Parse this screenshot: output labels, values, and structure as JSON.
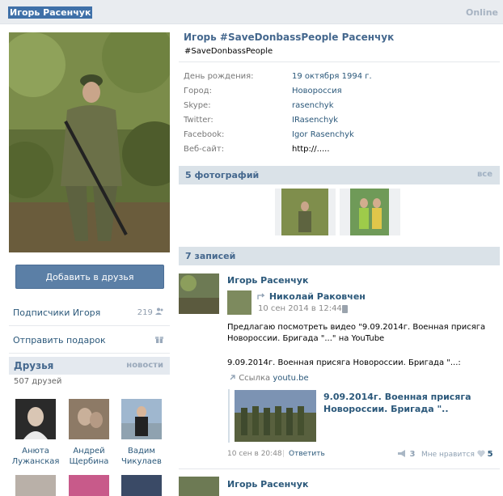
{
  "header": {
    "name": "Игорь Расенчук",
    "status": "Online"
  },
  "profile": {
    "full_name": "Игорь #SaveDonbassPeople Расенчук",
    "status_text": "#SaveDonbassPeople",
    "info": [
      {
        "key": "День рождения:",
        "value": "19 октября 1994 г."
      },
      {
        "key": "Город:",
        "value": "Новороссия"
      },
      {
        "key": "Skype:",
        "value": "rasenchyk"
      },
      {
        "key": "Twitter:",
        "value": "IRasenchyk"
      },
      {
        "key": "Facebook:",
        "value": "Igor Rasenchyk"
      },
      {
        "key": "Веб-сайт:",
        "value": "http://....."
      }
    ]
  },
  "left": {
    "add_friend": "Добавить в друзья",
    "subscribers_label": "Подписчики Игоря",
    "subscribers_count": "219",
    "gift_label": "Отправить подарок",
    "friends_title": "Друзья",
    "friends_news": "новости",
    "friends_count": "507 друзей",
    "friends": [
      {
        "first": "Анюта",
        "last": "Лужанская"
      },
      {
        "first": "Андрей",
        "last": "Щербина"
      },
      {
        "first": "Вадим",
        "last": "Чикулаев"
      }
    ]
  },
  "photos": {
    "title": "5 фотографий",
    "all": "все"
  },
  "wall": {
    "title": "7 записей",
    "post": {
      "author": "Игорь Расенчук",
      "repost_author": "Николай Раковчен",
      "repost_date": "10 сен 2014 в 12:44",
      "text": "Предлагаю посмотреть видео \"9.09.2014г. Военная присяга Новороссии. Бригада \"...\" на YouTube",
      "text2": "9.09.2014г. Военная присяга Новороссии. Бригада \"...:",
      "link_label": "Ссылка",
      "link_url": "youtu.be",
      "video_title": "9.09.2014г. Военная присяга Новороссии. Бригада \"..",
      "date": "10 сен в 20:48",
      "bar": "|",
      "reply": "Ответить",
      "shares": "3",
      "likes_label": "Мне нравится",
      "likes_count": "5"
    },
    "post2_author": "Игорь Расенчук"
  }
}
